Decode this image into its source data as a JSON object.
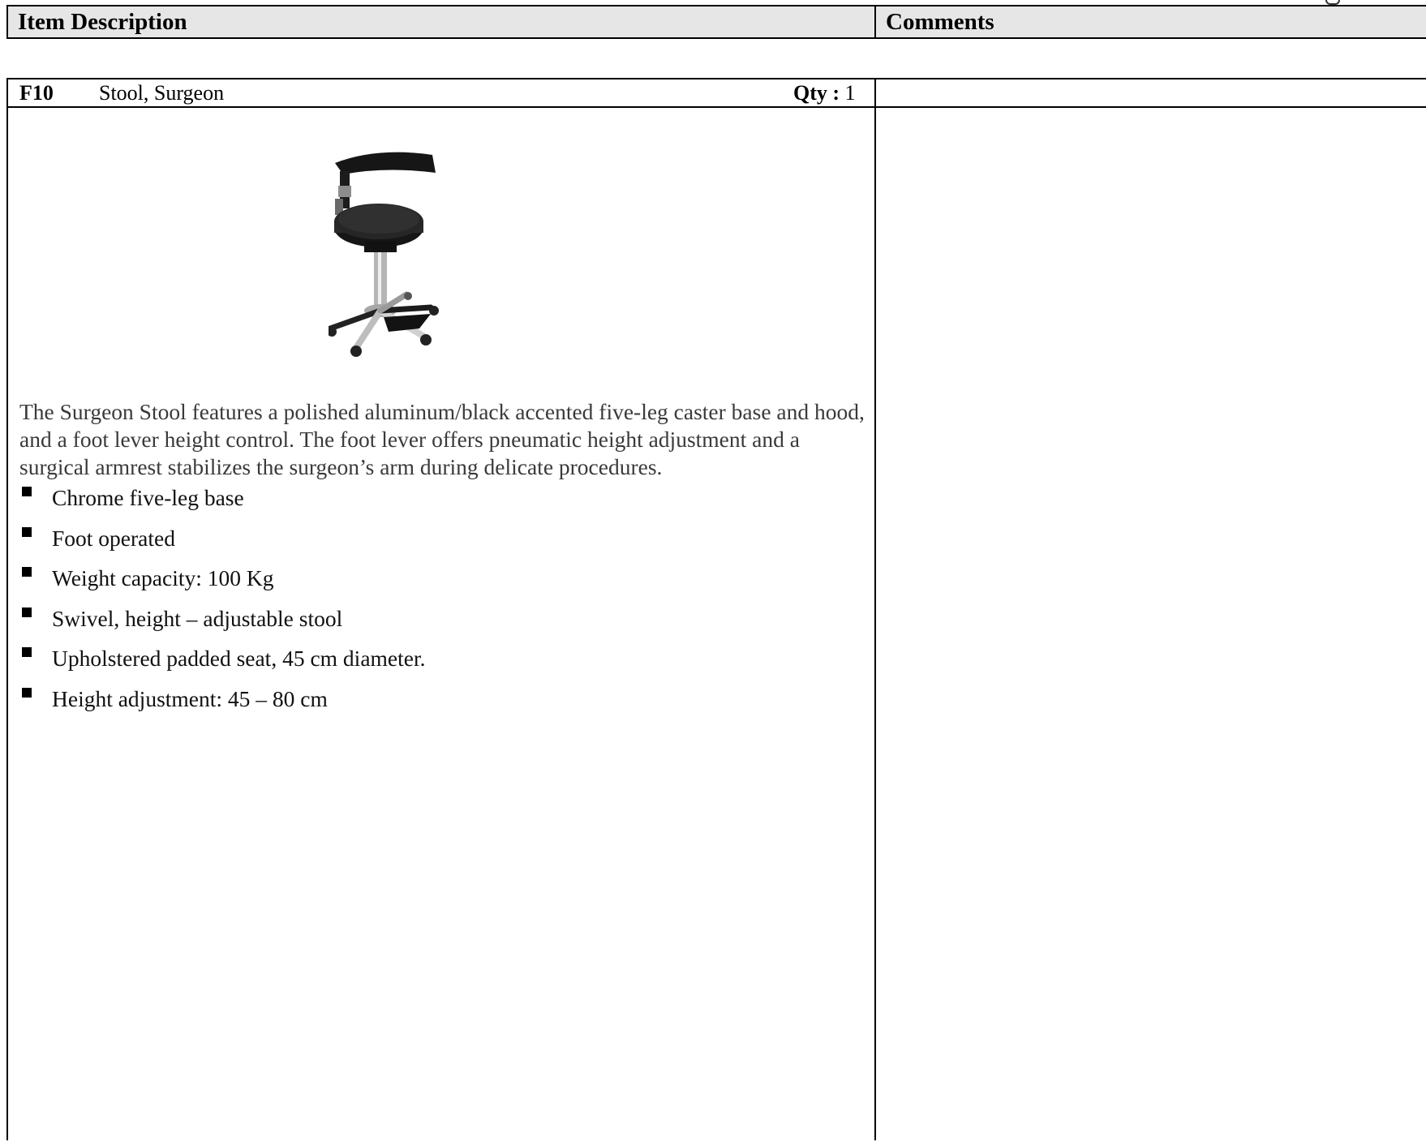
{
  "header": {
    "item_description_label": "Item Description",
    "comments_label": "Comments"
  },
  "item": {
    "code": "F10",
    "name": "Stool, Surgeon",
    "qty_label": "Qty :",
    "qty_value": "1",
    "comments": "",
    "image_icon": "surgeon-stool-illustration",
    "description": "The Surgeon Stool features a polished aluminum/black accented five-leg caster base and hood, and a foot lever height control. The foot lever offers pneumatic height adjustment and a surgical armrest stabilizes the surgeon’s arm during delicate procedures.",
    "features": [
      "Chrome five-leg base",
      "Foot operated",
      "Weight capacity: 100 Kg",
      "Swivel, height – adjustable stool",
      "Upholstered padded seat, 45 cm diameter.",
      "Height adjustment: 45 – 80  cm"
    ]
  }
}
